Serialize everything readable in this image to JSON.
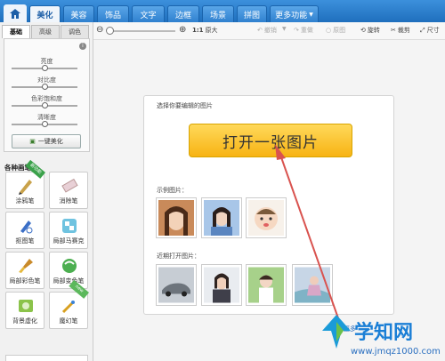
{
  "topbar": {
    "tabs": [
      {
        "label": "美化",
        "active": true
      },
      {
        "label": "美容"
      },
      {
        "label": "饰品"
      },
      {
        "label": "文字"
      },
      {
        "label": "边框"
      },
      {
        "label": "场景"
      },
      {
        "label": "拼图"
      },
      {
        "label": "更多功能"
      }
    ]
  },
  "toolbar": {
    "zoom_label": "1:1",
    "original_label": "原大",
    "undo": "撤销",
    "redo": "重做",
    "original_image": "原图",
    "rotate": "旋转",
    "crop": "裁剪",
    "size": "尺寸"
  },
  "left": {
    "subtabs": [
      "基础",
      "高级",
      "调色"
    ],
    "adjust": [
      "亮度",
      "对比度",
      "色彩饱和度",
      "清晰度"
    ],
    "oneclick": "一键美化",
    "brush_title": "各种画笔",
    "brushes": [
      {
        "label": "涂鸦笔",
        "badge": "新功能"
      },
      {
        "label": "消除笔"
      },
      {
        "label": "抠图笔"
      },
      {
        "label": "局部马赛克"
      },
      {
        "label": "局部彩色笔"
      },
      {
        "label": "局部变色笔"
      },
      {
        "label": "背景虚化"
      },
      {
        "label": "魔幻笔",
        "badge": "new"
      }
    ]
  },
  "card": {
    "title": "选择你要编辑的图片",
    "open_button": "打开一张图片",
    "sample_label": "示例图片：",
    "recent_label": "近期打开图片：",
    "more": "更多"
  },
  "watermark": {
    "text": "学知网",
    "url": "www.jmqz1000.com"
  },
  "colors": {
    "accent": "#2f80cf",
    "button": "#f7b314",
    "arrow": "#d9534f"
  }
}
